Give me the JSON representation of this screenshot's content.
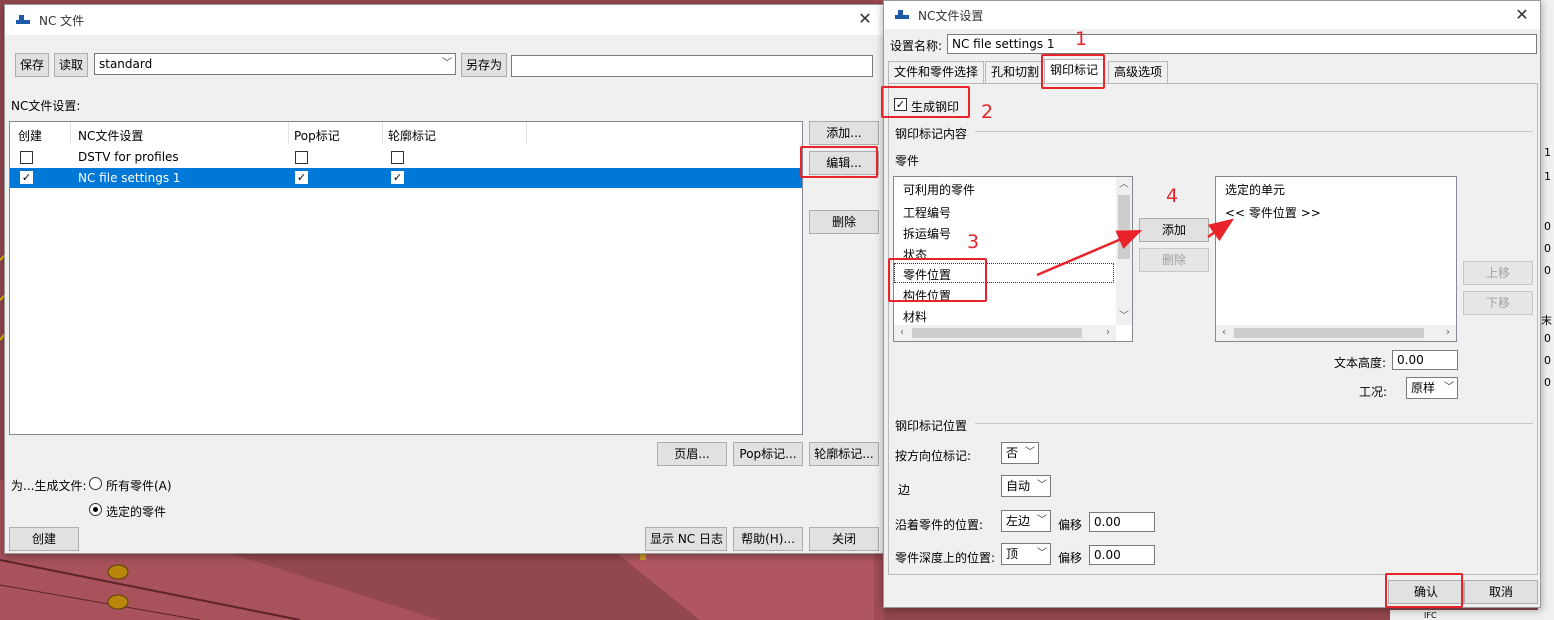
{
  "nc_file_window": {
    "title": "NC 文件",
    "save_label": "保存",
    "load_label": "读取",
    "preset_value": "standard",
    "save_as_label": "另存为",
    "save_as_value": "",
    "settings_heading": "NC文件设置:",
    "columns": [
      "创建",
      "NC文件设置",
      "Pop标记",
      "轮廓标记"
    ],
    "rows": [
      {
        "create": false,
        "name": "DSTV for profiles",
        "pop": false,
        "contour": false
      },
      {
        "create": true,
        "name": "NC file settings 1",
        "pop": true,
        "contour": true
      }
    ],
    "add_label": "添加...",
    "edit_label": "编辑...",
    "delete_label": "删除",
    "header_btn": "页眉...",
    "pop_btn": "Pop标记...",
    "contour_btn": "轮廓标记...",
    "generate_for_label": "为...生成文件:",
    "radio_all": "所有零件(A)",
    "radio_selected": "选定的零件",
    "create_label": "创建",
    "show_log_label": "显示 NC 日志",
    "help_label": "帮助(H)...",
    "close_label": "关闭"
  },
  "settings_window": {
    "title": "NC文件设置",
    "name_label": "设置名称:",
    "name_value": "NC file settings 1",
    "tabs": [
      "文件和零件选择",
      "孔和切割",
      "钢印标记",
      "高级选项"
    ],
    "generate_stamp_label": "生成钢印",
    "generate_stamp_checked": true,
    "content_group": "钢印标记内容",
    "parts_label": "零件",
    "available_header": "可利用的零件",
    "available_items": [
      "工程编号",
      "拆运编号",
      "状态",
      "零件位置",
      "构件位置",
      "材料"
    ],
    "add_label": "添加",
    "delete_label": "删除",
    "selected_header": "选定的单元",
    "selected_items": [
      "<< 零件位置 >>"
    ],
    "move_up_label": "上移",
    "move_down_label": "下移",
    "text_height_label": "文本高度:",
    "text_height_value": "0.00",
    "condition_label": "工况:",
    "condition_value": "原样",
    "position_group": "钢印标记位置",
    "direction_label": "按方向位标记:",
    "direction_value": "否",
    "edge_label": "边",
    "edge_value": "自动",
    "along_label": "沿着零件的位置:",
    "along_value": "左边",
    "offset_label": "偏移",
    "along_offset": "0.00",
    "depth_label": "零件深度上的位置:",
    "depth_value": "顶",
    "depth_offset": "0.00",
    "ok_label": "确认",
    "cancel_label": "取消"
  },
  "annotations": {
    "n1": "1",
    "n2": "2",
    "n3": "3",
    "n4": "4"
  },
  "background_fragments": [
    "1",
    "1",
    "0",
    "0",
    "0",
    "末",
    "0",
    "0",
    "0",
    "IFC"
  ],
  "colors": {
    "selection": "#0078d7",
    "annotation_red": "#e8242a",
    "background_model": "#8f4a52"
  }
}
